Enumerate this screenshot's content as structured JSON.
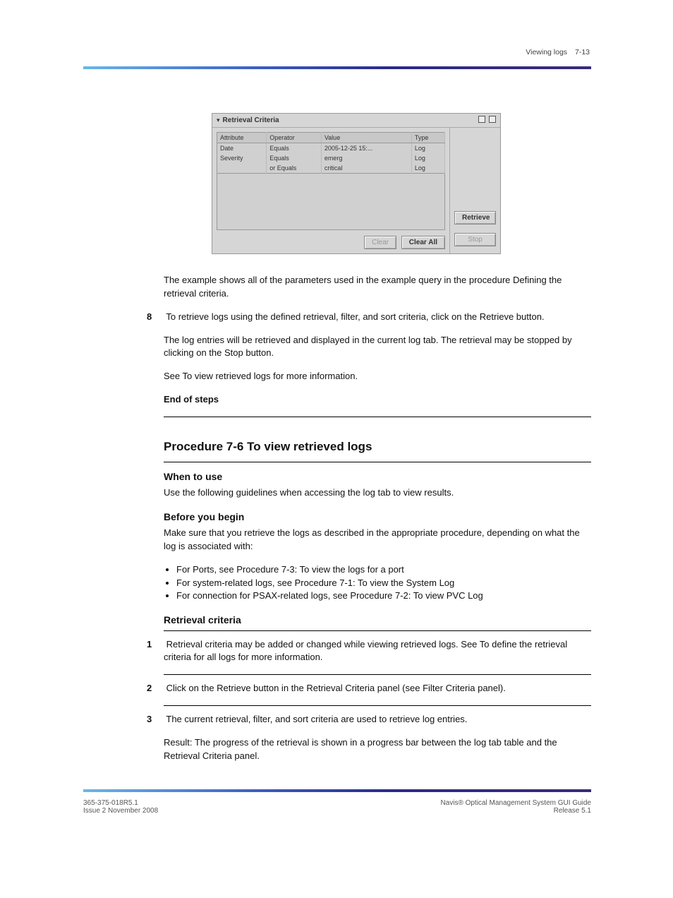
{
  "header": {
    "title": "Viewing logs",
    "section_number": "7-13"
  },
  "figure": {
    "panel_title": "Retrieval Criteria",
    "columns": {
      "c1": "Attribute",
      "c2": "Operator",
      "c3": "Value",
      "c4": "Type"
    },
    "rows": [
      {
        "attr": "Date",
        "op": "Equals",
        "val": "2005-12-25 15:...",
        "type": "Log"
      },
      {
        "attr": "Severity",
        "op": "Equals",
        "val": "emerg",
        "type": "Log"
      },
      {
        "attr": "",
        "op": "or Equals",
        "val": "critical",
        "type": "Log"
      }
    ],
    "buttons": {
      "clear": "Clear",
      "clear_all": "Clear All",
      "retrieve": "Retrieve",
      "stop": "Stop"
    }
  },
  "body": {
    "p_example": "The example shows all of the parameters used in the example query in the procedure Defining the retrieval criteria.",
    "step8_num": "8",
    "step8_a": "To retrieve logs using the defined retrieval, filter, and sort criteria, click on the Retrieve button.",
    "step8_b": "The log entries will be retrieved and displayed in the current log tab. The retrieval may be stopped by clicking on the Stop button.",
    "step8_c": "See To view retrieved logs for more information.",
    "end": "End of steps",
    "proc_title": "Procedure 7-6  To view retrieved logs",
    "when_title": "When to use",
    "when_body": "Use the following guidelines when accessing the log tab to view results.",
    "before_title": "Before you begin",
    "before_body": "Make sure that you retrieve the logs as described in the appropriate procedure, depending on what the log is associated with:",
    "bullets": {
      "b1": "For Ports, see Procedure 7-3: To view the logs for a port",
      "b2": "For system-related logs, see Procedure 7-1: To view the System Log",
      "b3": "For connection for PSAX-related logs, see Procedure 7-2: To view PVC Log"
    },
    "rc_title": "Retrieval criteria",
    "rc_steps": {
      "s1_num": "1",
      "s1": "Retrieval criteria may be added or changed while viewing retrieved logs. See To define the retrieval criteria for all logs for more information.",
      "s2_num": "2",
      "s2": "Click on the Retrieve button in the Retrieval Criteria panel (see Filter Criteria panel).",
      "s3_num": "3",
      "s3_a": "The current retrieval, filter, and sort criteria are used to retrieve log entries.",
      "s3_b": "Result: The progress of the retrieval is shown in a progress bar between the log tab table and the Retrieval Criteria panel."
    }
  },
  "footer": {
    "left_line1": "365-375-018R5.1",
    "left_line2": "Issue 2 November 2008",
    "right_line1": "Navis® Optical Management System GUI Guide",
    "right_line2": "Release 5.1"
  }
}
